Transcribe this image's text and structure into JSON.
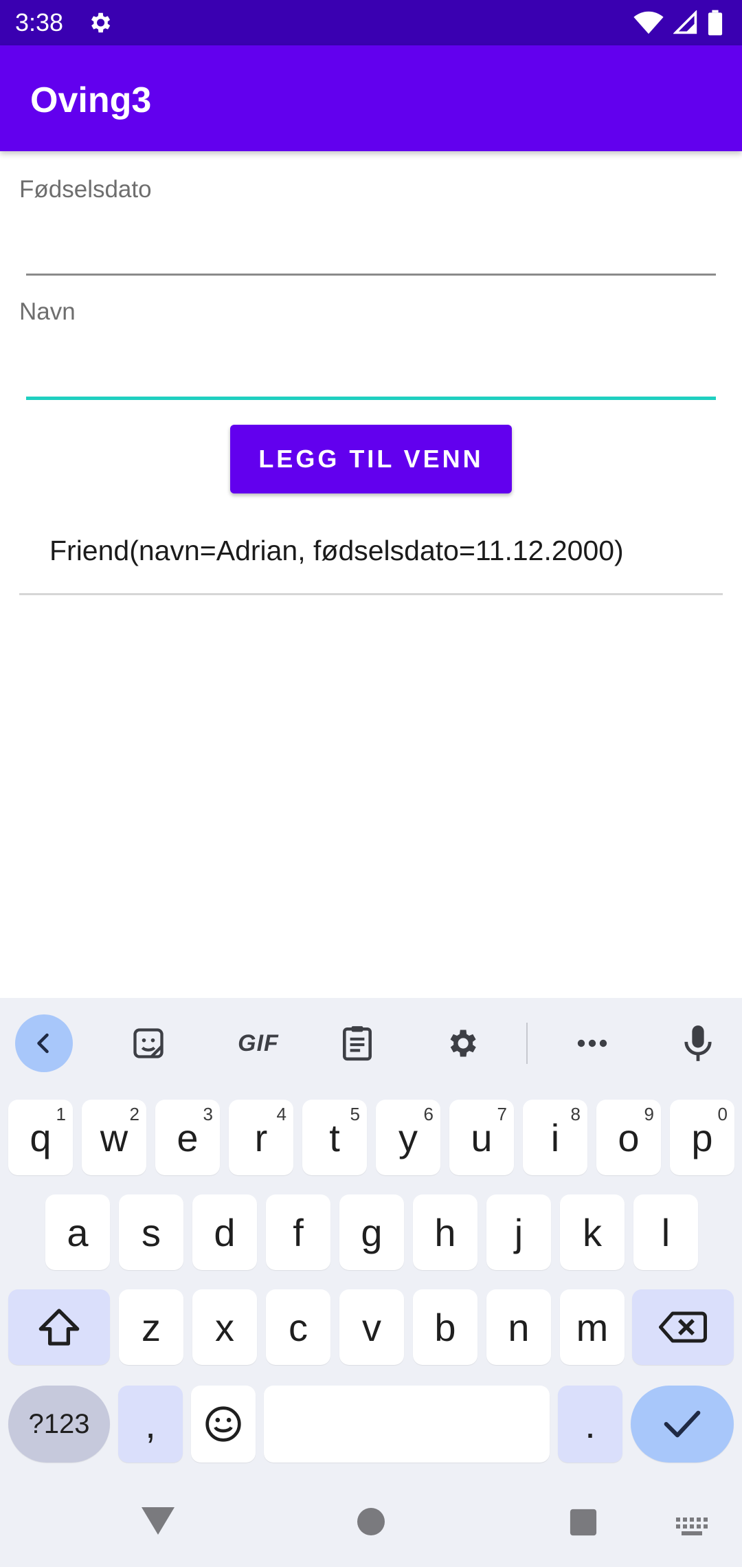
{
  "status_bar": {
    "time": "3:38",
    "icons": [
      "settings-icon",
      "wifi-icon",
      "signal-icon",
      "battery-icon"
    ]
  },
  "app_bar": {
    "title": "Oving3"
  },
  "form": {
    "dob_label": "Fødselsdato",
    "dob_value": "",
    "name_label": "Navn",
    "name_value": "",
    "add_button_label": "LEGG TIL VENN"
  },
  "friends": [
    {
      "text": "Friend(navn=Adrian, fødselsdato=11.12.2000)"
    }
  ],
  "keyboard": {
    "toolbar": [
      "back-icon",
      "sticker-icon",
      "gif-icon",
      "clipboard-icon",
      "settings-icon",
      "more-icon",
      "mic-icon"
    ],
    "gif_label": "GIF",
    "row1": [
      {
        "key": "q",
        "hint": "1"
      },
      {
        "key": "w",
        "hint": "2"
      },
      {
        "key": "e",
        "hint": "3"
      },
      {
        "key": "r",
        "hint": "4"
      },
      {
        "key": "t",
        "hint": "5"
      },
      {
        "key": "y",
        "hint": "6"
      },
      {
        "key": "u",
        "hint": "7"
      },
      {
        "key": "i",
        "hint": "8"
      },
      {
        "key": "o",
        "hint": "9"
      },
      {
        "key": "p",
        "hint": "0"
      }
    ],
    "row2": [
      "a",
      "s",
      "d",
      "f",
      "g",
      "h",
      "j",
      "k",
      "l"
    ],
    "row3": [
      "z",
      "x",
      "c",
      "v",
      "b",
      "n",
      "m"
    ],
    "symbols_label": "?123",
    "comma_label": ",",
    "period_label": "."
  },
  "colors": {
    "status_bar": "#3a00b1",
    "primary": "#6200ee",
    "accent_underline": "#1fcfc0",
    "keyboard_bg": "#eef0f6",
    "enter_key": "#a8c7fa"
  }
}
